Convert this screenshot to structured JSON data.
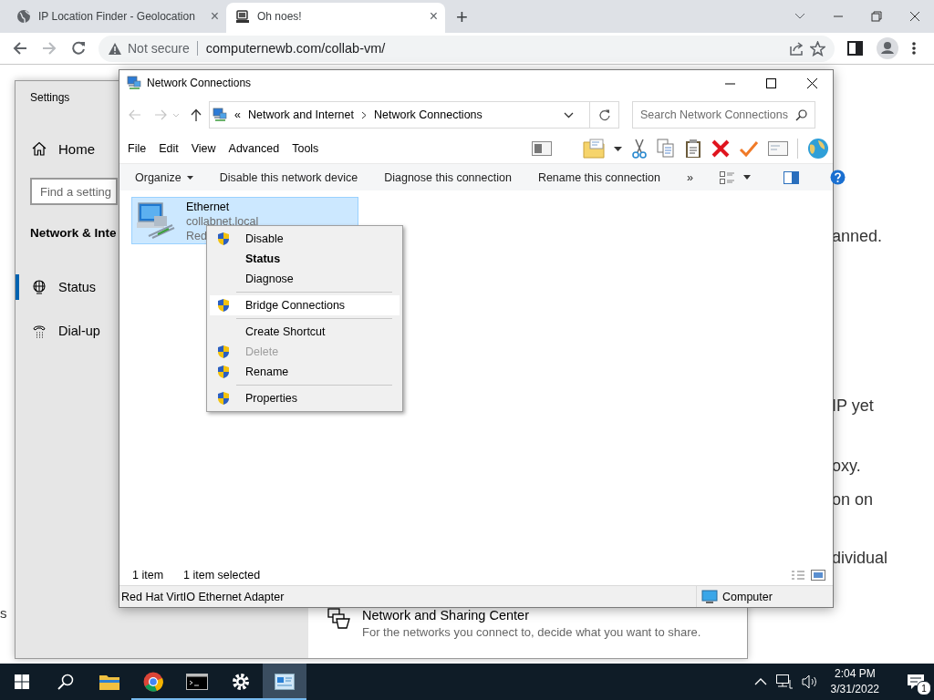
{
  "browser": {
    "tabs": [
      {
        "title": "IP Location Finder - Geolocation",
        "close": "×",
        "selected": false
      },
      {
        "title": "Oh noes!",
        "close": "×",
        "selected": true
      }
    ],
    "new_tab": "+",
    "forward_disabled": true,
    "security": "Not secure",
    "url": "computernewb.com/collab-vm/"
  },
  "page_fragments": [
    "anned.",
    "IP yet",
    "oxy.",
    "on on",
    "dividual"
  ],
  "edge_fragment": "s",
  "settings": {
    "title": "Settings",
    "home": "Home",
    "search": {
      "placeholder": "Find a setting"
    },
    "section": "Network & Inte",
    "nav": [
      {
        "label": "Status",
        "selected": true
      },
      {
        "label": "Dial-up",
        "selected": false
      }
    ],
    "sharing_center": {
      "title": "Network and Sharing Center",
      "description": "For the networks you connect to, decide what you want to share."
    }
  },
  "explorer": {
    "title": "Network Connections",
    "overflow": "«",
    "breadcrumb": [
      "Network and Internet",
      "Network Connections"
    ],
    "search": {
      "placeholder": "Search Network Connections"
    },
    "menu": [
      "File",
      "Edit",
      "View",
      "Advanced",
      "Tools"
    ],
    "commands": [
      {
        "label": "Organize",
        "dropdown": true
      },
      {
        "label": "Disable this network device",
        "dropdown": false
      },
      {
        "label": "Diagnose this connection",
        "dropdown": false
      },
      {
        "label": "Rename this connection",
        "dropdown": false
      }
    ],
    "more": "»",
    "items": [
      {
        "name": "Ethernet",
        "network": "collabnet.local",
        "device": "Red",
        "selected": true
      }
    ],
    "status": {
      "count": "1 item",
      "selection": "1 item selected"
    },
    "details": {
      "adapter": "Red Hat VirtIO Ethernet Adapter",
      "location": "Computer"
    }
  },
  "context_menu": [
    {
      "kind": "item",
      "label": "Disable",
      "shield": true,
      "bold": false,
      "disabled": false,
      "selected": false
    },
    {
      "kind": "item",
      "label": "Status",
      "shield": false,
      "bold": true,
      "disabled": false,
      "selected": false
    },
    {
      "kind": "item",
      "label": "Diagnose",
      "shield": false,
      "bold": false,
      "disabled": false,
      "selected": false
    },
    {
      "kind": "separator"
    },
    {
      "kind": "item",
      "label": "Bridge Connections",
      "shield": true,
      "bold": false,
      "disabled": false,
      "selected": true
    },
    {
      "kind": "separator"
    },
    {
      "kind": "item",
      "label": "Create Shortcut",
      "shield": false,
      "bold": false,
      "disabled": false,
      "selected": false
    },
    {
      "kind": "item",
      "label": "Delete",
      "shield": true,
      "bold": false,
      "disabled": true,
      "selected": false
    },
    {
      "kind": "item",
      "label": "Rename",
      "shield": true,
      "bold": false,
      "disabled": false,
      "selected": false
    },
    {
      "kind": "separator"
    },
    {
      "kind": "item",
      "label": "Properties",
      "shield": true,
      "bold": false,
      "disabled": false,
      "selected": false
    }
  ],
  "taskbar": {
    "apps": [
      {
        "running": false,
        "selected": false
      },
      {
        "running": true,
        "selected": false
      },
      {
        "running": true,
        "selected": false
      },
      {
        "running": true,
        "selected": false
      },
      {
        "running": true,
        "selected": true
      }
    ],
    "time": "2:04 PM",
    "date": "3/31/2022",
    "notifications": "1"
  }
}
